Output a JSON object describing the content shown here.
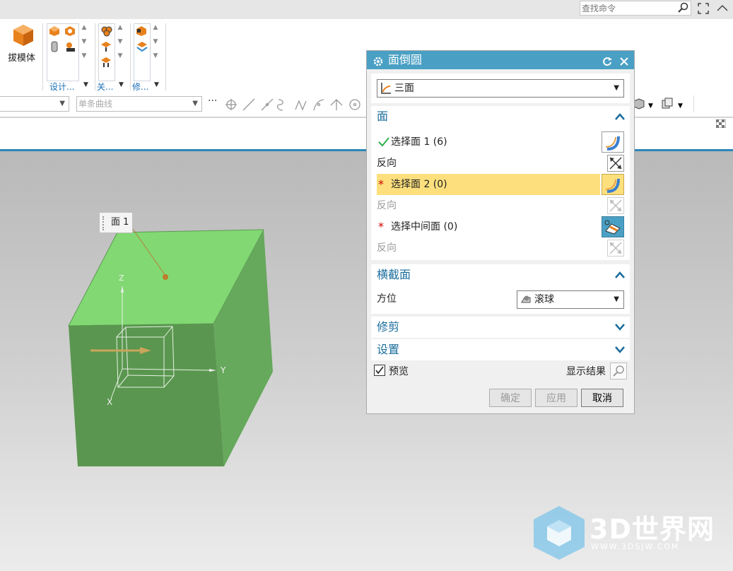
{
  "topbar": {
    "search_placeholder": "查找命令"
  },
  "ribbon": {
    "draft_label": "拔模体",
    "group_design": "设计...",
    "group_relate": "关...",
    "group_modify": "修..."
  },
  "filterbar": {
    "curve_rule": "单条曲线"
  },
  "viewport": {
    "face_tag": "面 1",
    "axes": {
      "z": "Z",
      "y": "Y",
      "x": "X"
    }
  },
  "dialog": {
    "title": "面倒圆",
    "type_value": "三面",
    "sections": {
      "face": {
        "title": "面",
        "select_face1": "选择面 1 (6)",
        "reverse1": "反向",
        "select_face2": "选择面 2 (0)",
        "reverse2": "反向",
        "select_middle": "选择中间面 (0)",
        "reverse3": "反向"
      },
      "cross_section": {
        "title": "横截面",
        "orientation_label": "方位",
        "orientation_value": "滚球"
      },
      "trim": {
        "title": "修剪"
      },
      "settings": {
        "title": "设置"
      }
    },
    "preview_label": "预览",
    "preview_checked": true,
    "show_result_label": "显示结果",
    "ok_label": "确定",
    "apply_label": "应用",
    "cancel_label": "取消"
  },
  "watermark": {
    "brand": "3D世界网",
    "url": "WWW.3DSJW.COM"
  },
  "colors": {
    "accent": "#4aa0c4",
    "highlight": "#fde07d",
    "cube": "#5a9a52",
    "cube_top": "#82d873"
  }
}
